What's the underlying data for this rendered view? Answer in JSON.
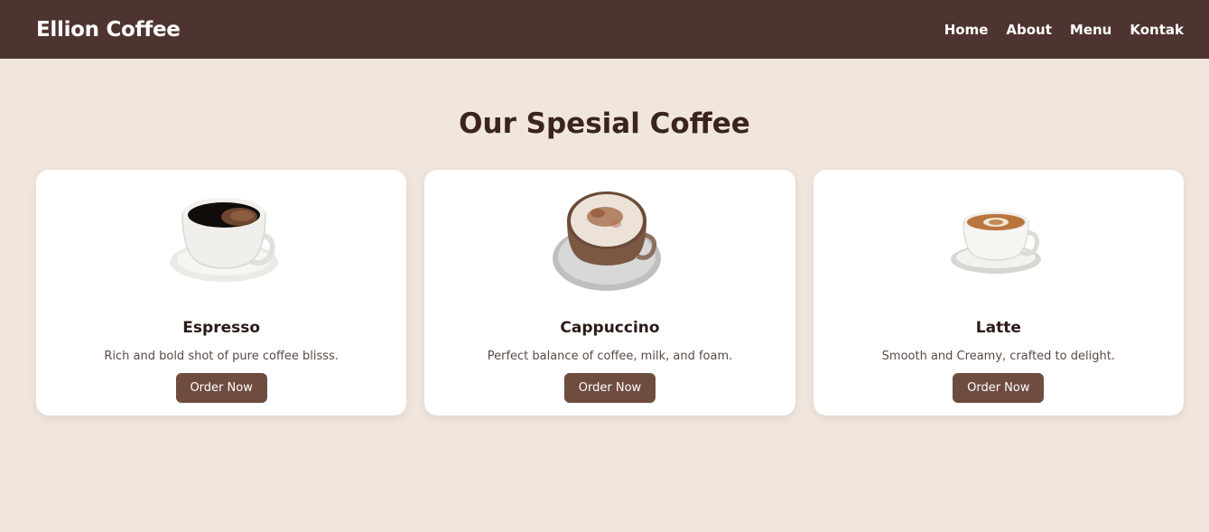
{
  "navbar": {
    "brand": "Ellion Coffee",
    "links": [
      "Home",
      "About",
      "Menu",
      "Kontak"
    ]
  },
  "main": {
    "title": "Our Spesial Coffee",
    "cards": [
      {
        "name": "Espresso",
        "description": "Rich and bold shot of pure coffee blisss.",
        "button": "Order Now",
        "image_icon": "espresso-cup-icon"
      },
      {
        "name": "Cappuccino",
        "description": "Perfect balance of coffee, milk, and foam.",
        "button": "Order Now",
        "image_icon": "cappuccino-cup-icon"
      },
      {
        "name": "Latte",
        "description": "Smooth and Creamy, crafted to delight.",
        "button": "Order Now",
        "image_icon": "latte-cup-icon"
      }
    ]
  },
  "colors": {
    "navbar": "#4e3430",
    "background": "#f0e6de",
    "button": "#6e4c40",
    "title": "#3b2420"
  }
}
